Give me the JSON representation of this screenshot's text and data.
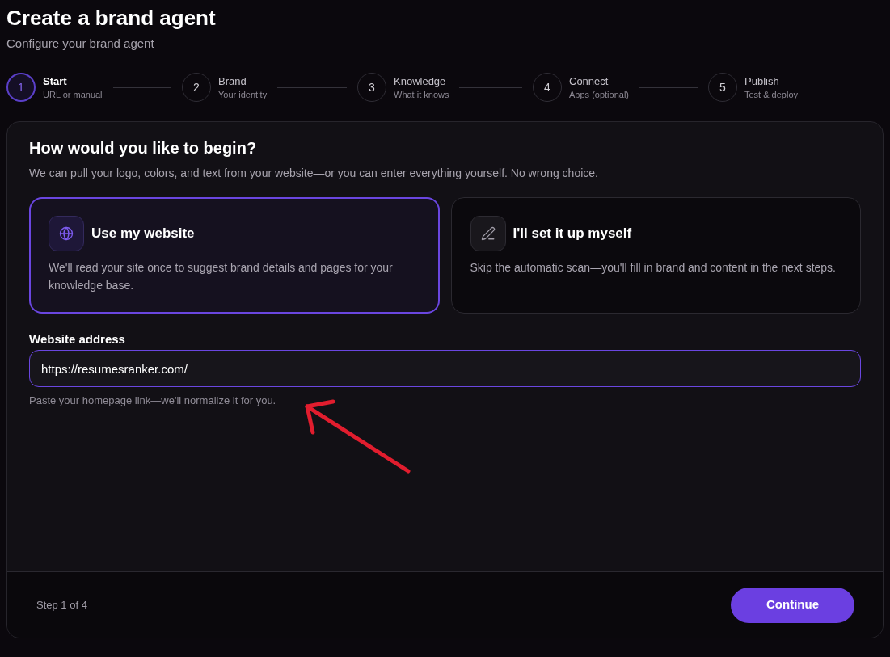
{
  "header": {
    "title": "Create a brand agent",
    "subtitle": "Configure your brand agent"
  },
  "steps": [
    {
      "number": "1",
      "title": "Start",
      "subtitle": "URL or manual",
      "selected": true
    },
    {
      "number": "2",
      "title": "Brand",
      "subtitle": "Your identity",
      "selected": false
    },
    {
      "number": "3",
      "title": "Knowledge",
      "subtitle": "What it knows",
      "selected": false
    },
    {
      "number": "4",
      "title": "Connect",
      "subtitle": "Apps (optional)",
      "selected": false
    },
    {
      "number": "5",
      "title": "Publish",
      "subtitle": "Test & deploy",
      "selected": false
    }
  ],
  "card": {
    "heading": "How would you like to begin?",
    "description": "We can pull your logo, colors, and text from your website—or you can enter everything yourself. No wrong choice.",
    "options": [
      {
        "kind": "website",
        "title": "Use my website",
        "description": "We'll read your site once to suggest brand details and pages for your knowledge base.",
        "selected": true
      },
      {
        "kind": "manual",
        "title": "I'll set it up myself",
        "description": "Skip the automatic scan—you'll fill in brand and content in the next steps.",
        "selected": false
      }
    ],
    "field": {
      "label": "Website address",
      "value": "https://resumesranker.com/",
      "hint": "Paste your homepage link—we'll normalize it for you."
    }
  },
  "footer": {
    "step_label": "Step 1 of 4",
    "button": "Continue"
  },
  "annotations": [
    {
      "kind": "arrow",
      "color": "#e11d2e"
    }
  ]
}
